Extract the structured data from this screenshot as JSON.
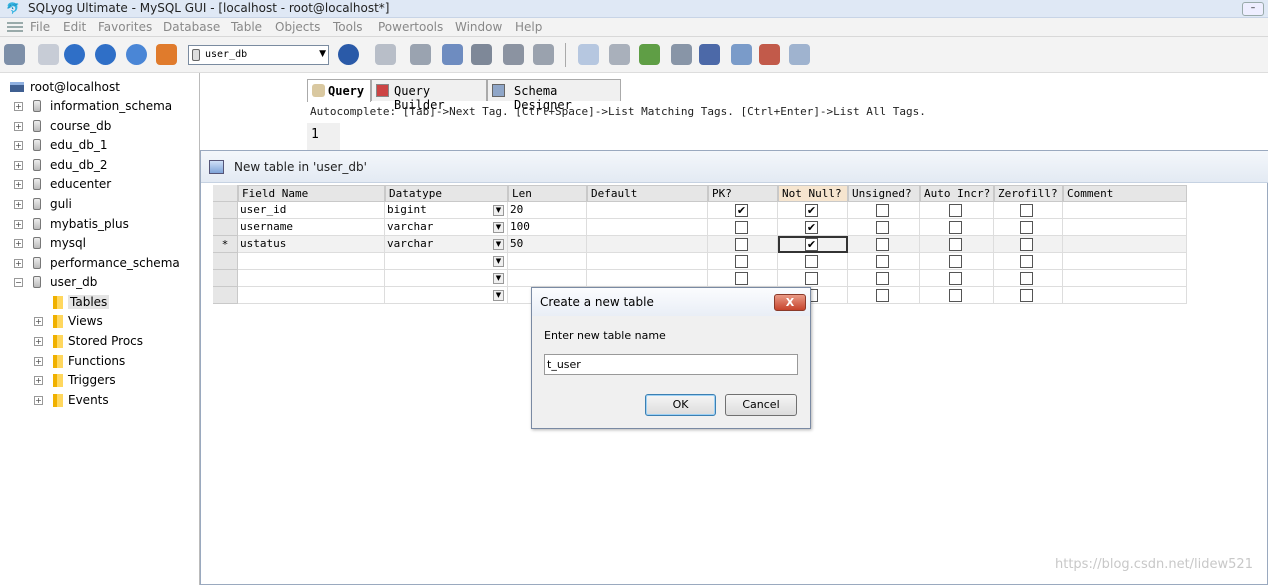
{
  "app": {
    "title": "SQLyog Ultimate - MySQL GUI - [localhost - root@localhost*]"
  },
  "menu": [
    "File",
    "Edit",
    "Favorites",
    "Database",
    "Table",
    "Objects",
    "Tools",
    "Powertools",
    "Window",
    "Help"
  ],
  "toolbar": {
    "db_select_value": "user_db"
  },
  "object_browser": {
    "connection": "root@localhost",
    "databases": [
      "information_schema",
      "course_db",
      "edu_db_1",
      "edu_db_2",
      "educenter",
      "guli",
      "mybatis_plus",
      "mysql",
      "performance_schema",
      "user_db"
    ],
    "user_db_children": [
      "Tables",
      "Views",
      "Stored Procs",
      "Functions",
      "Triggers",
      "Events"
    ]
  },
  "tabs": [
    "Query",
    "Query Builder",
    "Schema Designer"
  ],
  "autocomplete_hint": "Autocomplete: [Tab]->Next Tag. [Ctrl+Space]->List Matching Tags. [Ctrl+Enter]->List All Tags.",
  "editor": {
    "line_number": "1"
  },
  "new_table_window": {
    "title": "New table in 'user_db'",
    "columns": [
      "Field Name",
      "Datatype",
      "Len",
      "Default",
      "PK?",
      "Not Null?",
      "Unsigned?",
      "Auto Incr?",
      "Zerofill?",
      "Comment"
    ],
    "rows": [
      {
        "marker": "",
        "field": "user_id",
        "datatype": "bigint",
        "len": "20",
        "default": "",
        "pk": true,
        "notnull": true,
        "unsigned": false,
        "autoincr": false,
        "zerofill": false
      },
      {
        "marker": "",
        "field": "username",
        "datatype": "varchar",
        "len": "100",
        "default": "",
        "pk": false,
        "notnull": true,
        "unsigned": false,
        "autoincr": false,
        "zerofill": false
      },
      {
        "marker": "*",
        "field": "ustatus",
        "datatype": "varchar",
        "len": "50",
        "default": "",
        "pk": false,
        "notnull": true,
        "unsigned": false,
        "autoincr": false,
        "zerofill": false
      },
      {
        "marker": "",
        "field": "",
        "datatype": "",
        "len": "",
        "default": "",
        "pk": false,
        "notnull": false,
        "unsigned": false,
        "autoincr": false,
        "zerofill": false
      },
      {
        "marker": "",
        "field": "",
        "datatype": "",
        "len": "",
        "default": "",
        "pk": false,
        "notnull": false,
        "unsigned": false,
        "autoincr": false,
        "zerofill": false
      },
      {
        "marker": "",
        "field": "",
        "datatype": "",
        "len": "",
        "default": "",
        "pk": false,
        "notnull": false,
        "unsigned": false,
        "autoincr": false,
        "zerofill": false
      }
    ]
  },
  "dialog": {
    "title": "Create a new table",
    "close_label": "X",
    "prompt": "Enter new table name",
    "input_value": "t_user",
    "ok_label": "OK",
    "cancel_label": "Cancel"
  },
  "watermark": "https://blog.csdn.net/lidew521"
}
